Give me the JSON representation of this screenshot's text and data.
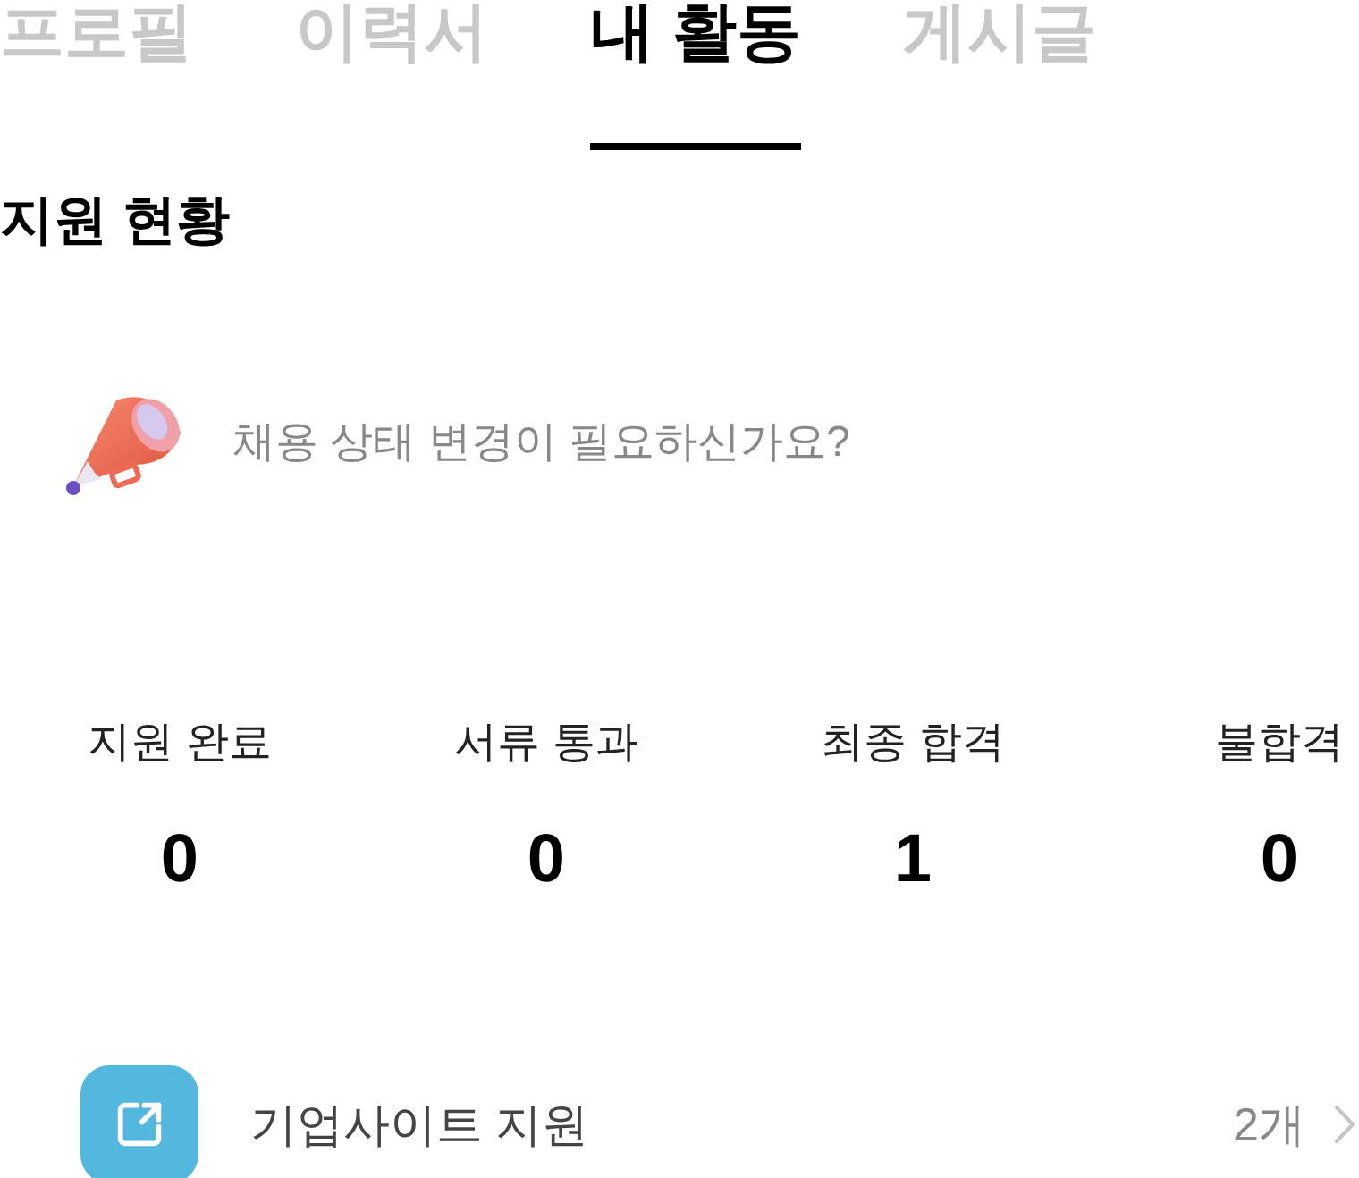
{
  "tabs": [
    {
      "label": "프로필",
      "selected": false
    },
    {
      "label": "이력서",
      "selected": false
    },
    {
      "label": "내 활동",
      "selected": true
    },
    {
      "label": "게시글",
      "selected": false
    }
  ],
  "section_title": "지원 현황",
  "banner": {
    "text": "채용 상태 변경이 필요하신가요?"
  },
  "stats": [
    {
      "label": "지원 완료",
      "value": "0"
    },
    {
      "label": "서류 통과",
      "value": "0"
    },
    {
      "label": "최종 합격",
      "value": "1"
    },
    {
      "label": "불합격",
      "value": "0"
    }
  ],
  "list": [
    {
      "label": "기업사이트 지원",
      "count": "2개"
    }
  ]
}
